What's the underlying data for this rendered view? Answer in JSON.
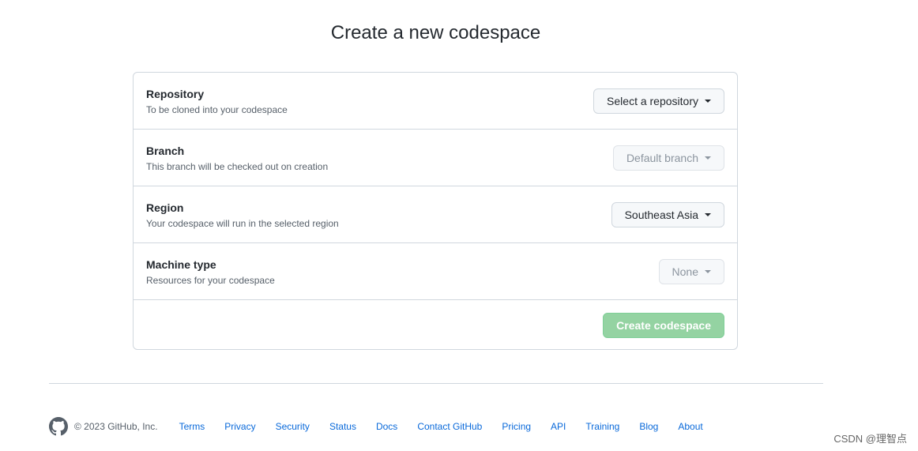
{
  "page": {
    "title": "Create a new codespace"
  },
  "form": {
    "rows": [
      {
        "label": "Repository",
        "description": "To be cloned into your codespace",
        "button": "Select a repository"
      },
      {
        "label": "Branch",
        "description": "This branch will be checked out on creation",
        "button": "Default branch"
      },
      {
        "label": "Region",
        "description": "Your codespace will run in the selected region",
        "button": "Southeast Asia"
      },
      {
        "label": "Machine type",
        "description": "Resources for your codespace",
        "button": "None"
      }
    ],
    "submit_label": "Create codespace"
  },
  "footer": {
    "copyright": "© 2023 GitHub, Inc.",
    "links": [
      "Terms",
      "Privacy",
      "Security",
      "Status",
      "Docs",
      "Contact GitHub",
      "Pricing",
      "API",
      "Training",
      "Blog",
      "About"
    ]
  },
  "watermark": "CSDN @理智点",
  "icons": {
    "logo": "github-mark-icon",
    "dropdown": "caret-down-icon"
  },
  "colors": {
    "accent_link": "#0969da",
    "submit_disabled": "#94d3a2",
    "border": "#d0d7de"
  }
}
